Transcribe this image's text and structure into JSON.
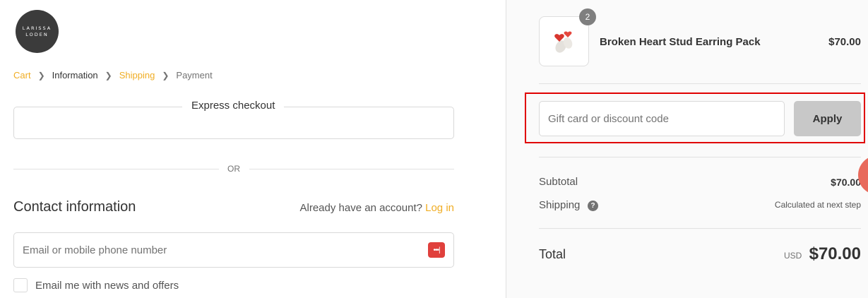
{
  "brand": {
    "logo_line1": "LARISSA",
    "logo_line2": "LODEN"
  },
  "breadcrumb": {
    "cart": "Cart",
    "information": "Information",
    "shipping": "Shipping",
    "payment": "Payment"
  },
  "express": {
    "title": "Express checkout",
    "or": "OR"
  },
  "contact": {
    "title": "Contact information",
    "account_prompt": "Already have an account?",
    "login_link": "Log in",
    "email_placeholder": "Email or mobile phone number",
    "newsletter_label": "Email me with news and offers"
  },
  "cart": {
    "quantity": "2",
    "product_name": "Broken Heart Stud Earring Pack",
    "product_price": "$70.00"
  },
  "discount": {
    "placeholder": "Gift card or discount code",
    "apply_label": "Apply"
  },
  "summary": {
    "subtotal_label": "Subtotal",
    "subtotal_value": "$70.00",
    "shipping_label": "Shipping",
    "shipping_value": "Calculated at next step",
    "total_label": "Total",
    "currency": "USD",
    "total_value": "$70.00"
  },
  "colors": {
    "accent": "#f0ad24",
    "highlight": "#e00000",
    "apply_bg": "#c8c8c8"
  }
}
